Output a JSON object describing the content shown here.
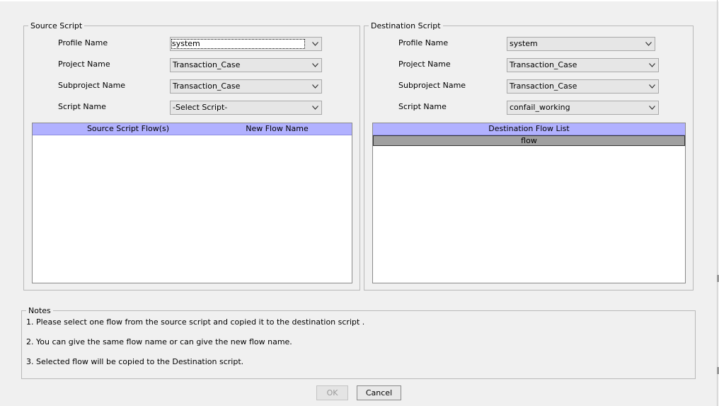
{
  "source": {
    "legend": "Source Script",
    "profile": {
      "label": "Profile Name",
      "value": "system"
    },
    "project": {
      "label": "Project Name",
      "value": "Transaction_Case"
    },
    "subproject": {
      "label": "Subproject Name",
      "value": "Transaction_Case"
    },
    "script": {
      "label": "Script Name",
      "value": "-Select Script-"
    },
    "table": {
      "columns": [
        "Source Script Flow(s)",
        "New Flow Name"
      ],
      "rows": []
    }
  },
  "destination": {
    "legend": "Destination Script",
    "profile": {
      "label": "Profile Name",
      "value": "system"
    },
    "project": {
      "label": "Project Name",
      "value": "Transaction_Case"
    },
    "subproject": {
      "label": "Subproject Name",
      "value": "Transaction_Case"
    },
    "script": {
      "label": "Script Name",
      "value": "confail_working"
    },
    "table": {
      "header": "Destination Flow List",
      "rows": [
        "flow"
      ]
    }
  },
  "notes": {
    "legend": "Notes",
    "lines": [
      "1. Please select one flow from the source script and copied it to the destination script .",
      "2. You can give the same flow name or can give the new flow name.",
      "3. Selected flow will be copied to the Destination script."
    ]
  },
  "buttons": {
    "ok": "OK",
    "cancel": "Cancel"
  },
  "colors": {
    "table_header": "#b1b1ff",
    "selected_row": "#a0a0a0",
    "background": "#f0f0f0"
  }
}
